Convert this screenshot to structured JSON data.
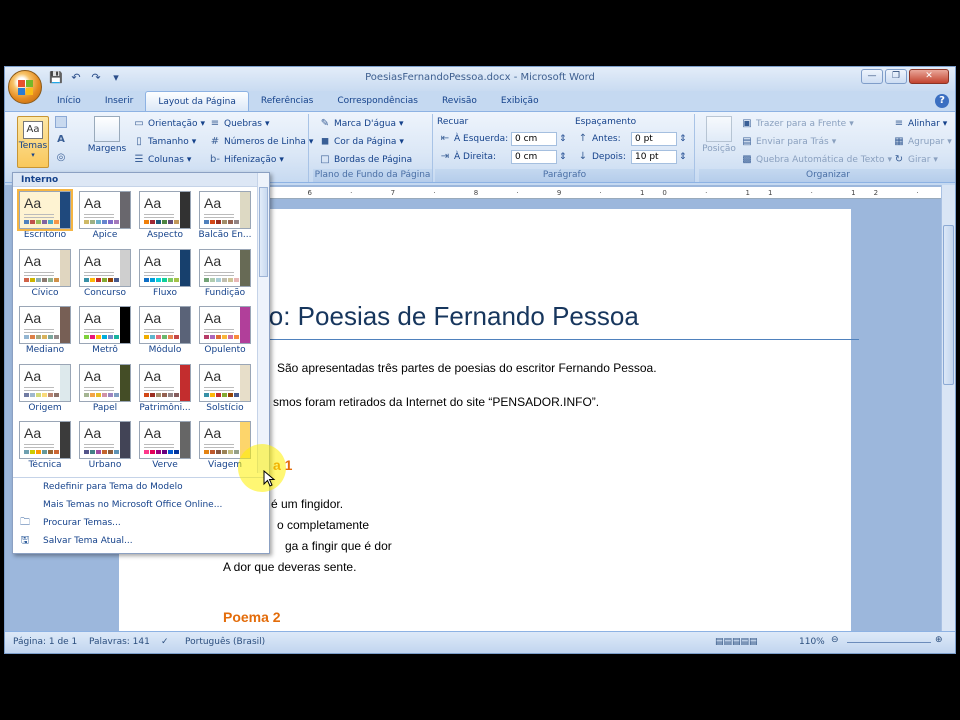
{
  "window": {
    "title": "PoesiasFernandoPessoa.docx - Microsoft Word"
  },
  "quick_access": {
    "icons": [
      "save-icon",
      "undo-icon",
      "redo-icon",
      "customize-icon"
    ]
  },
  "tabs": [
    "Início",
    "Inserir",
    "Layout da Página",
    "Referências",
    "Correspondências",
    "Revisão",
    "Exibição"
  ],
  "active_tab": "Layout da Página",
  "ribbon": {
    "temas_label": "Temas",
    "margens_label": "Margens",
    "orientacao": "Orientação",
    "tamanho": "Tamanho",
    "colunas": "Colunas",
    "quebras": "Quebras",
    "numeros_linha": "Números de Linha",
    "hifenizacao": "Hifenização",
    "marca_dagua": "Marca D'água",
    "cor_pagina": "Cor da Página",
    "bordas_pagina": "Bordas de Página",
    "plano_fundo_label": "Plano de Fundo da Página",
    "recuar": "Recuar",
    "esquerda_label": "À Esquerda:",
    "esquerda_value": "0 cm",
    "direita_label": "À Direita:",
    "direita_value": "0 cm",
    "espacamento": "Espaçamento",
    "antes_label": "Antes:",
    "antes_value": "0 pt",
    "depois_label": "Depois:",
    "depois_value": "10 pt",
    "paragrafo_label": "Parágrafo",
    "posicao": "Posição",
    "trazer_frente": "Trazer para a Frente",
    "enviar_tras": "Enviar para Trás",
    "quebra_automatica": "Quebra Automática de Texto",
    "alinhar": "Alinhar",
    "agrupar": "Agrupar",
    "girar": "Girar",
    "organizar_label": "Organizar"
  },
  "ruler": {
    "ticks": "· 6 · 7 · 8 · 9 · 10 · 11 · 12 · 13 · 14 · 15 · 16 · 17 ·"
  },
  "document": {
    "title": "lo: Poesias de Fernando Pessoa",
    "intro1": "São apresentadas três partes de poesias do escritor Fernando Pessoa.",
    "intro2": "smos foram retirados da Internet do site “PENSADOR.INFO”.",
    "poema1_heading": "a 1",
    "line1": "é um fingidor.",
    "line2": "o completamente",
    "line3": "ga a fingir que é dor",
    "line4": "A dor que deveras sente.",
    "poema2_heading": "Poema 2"
  },
  "gallery": {
    "header": "Interno",
    "themes": [
      {
        "name": "Escritório",
        "bar": "#1f497d",
        "sw": [
          "#4f81bd",
          "#c0504d",
          "#9bbb59",
          "#8064a2",
          "#4bacc6",
          "#f79646"
        ],
        "selected": true
      },
      {
        "name": "Ápice",
        "bar": "#69676d",
        "sw": [
          "#ceb966",
          "#9cb084",
          "#6bb1c9",
          "#6585cf",
          "#7e6bc9",
          "#a379bb"
        ],
        "selected": false
      },
      {
        "name": "Aspecto",
        "bar": "#323232",
        "sw": [
          "#f07f09",
          "#9f2936",
          "#1b587c",
          "#4e8542",
          "#604878",
          "#c19859"
        ],
        "selected": false
      },
      {
        "name": "Balcão En...",
        "bar": "#ddd9c3",
        "sw": [
          "#4f81bd",
          "#d34817",
          "#9b2d1f",
          "#a28e6a",
          "#956251",
          "#918485"
        ],
        "selected": false
      },
      {
        "name": "Cívico",
        "bar": "#e0d6c0",
        "sw": [
          "#d16349",
          "#ccb400",
          "#8cadae",
          "#8c7b70",
          "#8fb08c",
          "#d19049"
        ],
        "selected": false
      },
      {
        "name": "Concurso",
        "bar": "#cfcfcf",
        "sw": [
          "#3891a7",
          "#feb80a",
          "#c32d2e",
          "#84aa33",
          "#964305",
          "#475a8d"
        ],
        "selected": false
      },
      {
        "name": "Fluxo",
        "bar": "#17406d",
        "sw": [
          "#0f6fc6",
          "#009dd9",
          "#0bd0d9",
          "#10cf9b",
          "#7cca62",
          "#a5c249"
        ],
        "selected": false
      },
      {
        "name": "Fundição",
        "bar": "#676a55",
        "sw": [
          "#72a376",
          "#b0ccb0",
          "#a8cdd7",
          "#c0beaf",
          "#cec597",
          "#e8b7b7"
        ],
        "selected": false
      },
      {
        "name": "Mediano",
        "bar": "#775f55",
        "sw": [
          "#94b6d2",
          "#dd8047",
          "#a5ab81",
          "#d8b25c",
          "#7ba79d",
          "#968c8c"
        ],
        "selected": false
      },
      {
        "name": "Metrô",
        "bar": "#000000",
        "sw": [
          "#7fd13b",
          "#ea157a",
          "#feb80a",
          "#00addc",
          "#738ac8",
          "#1ab39f"
        ],
        "selected": false
      },
      {
        "name": "Módulo",
        "bar": "#5a6378",
        "sw": [
          "#f0ad00",
          "#60b5cc",
          "#e66c7d",
          "#6bb76d",
          "#e88651",
          "#c64847"
        ],
        "selected": false
      },
      {
        "name": "Opulento",
        "bar": "#b13f9a",
        "sw": [
          "#b83d68",
          "#ac66bb",
          "#de6c36",
          "#f9b639",
          "#cf6da4",
          "#fa8d3d"
        ],
        "selected": false
      },
      {
        "name": "Origem",
        "bar": "#dde9ec",
        "sw": [
          "#727ca3",
          "#9fb8cd",
          "#d2da7a",
          "#fada7a",
          "#b88472",
          "#8e736a"
        ],
        "selected": false
      },
      {
        "name": "Papel",
        "bar": "#444d26",
        "sw": [
          "#a5b592",
          "#f3a447",
          "#e7bc29",
          "#d092a7",
          "#9c85c0",
          "#809ec2"
        ],
        "selected": false
      },
      {
        "name": "Patrimôni...",
        "bar": "#c32d2e",
        "sw": [
          "#d34817",
          "#9b2d1f",
          "#a28e6a",
          "#956251",
          "#918485",
          "#855d5d"
        ],
        "selected": false
      },
      {
        "name": "Solstício",
        "bar": "#e7dec9",
        "sw": [
          "#3891a7",
          "#feb80a",
          "#c32d2e",
          "#84aa33",
          "#964305",
          "#475a8d"
        ],
        "selected": false
      },
      {
        "name": "Técnica",
        "bar": "#3b3b3b",
        "sw": [
          "#6ea0b0",
          "#cccc00",
          "#ff9900",
          "#669999",
          "#996633",
          "#cc6633"
        ],
        "selected": false
      },
      {
        "name": "Urbano",
        "bar": "#424456",
        "sw": [
          "#53548a",
          "#438086",
          "#a04da3",
          "#c4652d",
          "#8b5d3d",
          "#5c92b5"
        ],
        "selected": false
      },
      {
        "name": "Verve",
        "bar": "#666666",
        "sw": [
          "#ff388c",
          "#e40059",
          "#9c007f",
          "#68007f",
          "#005bd3",
          "#00349e"
        ],
        "selected": false
      },
      {
        "name": "Viagem",
        "bar": "#fdd56b",
        "sw": [
          "#e48312",
          "#bd582c",
          "#865640",
          "#9b8357",
          "#c2bc80",
          "#94a088"
        ],
        "selected": false
      }
    ],
    "menu": [
      {
        "label": "Redefinir para Tema do Modelo",
        "icon": ""
      },
      {
        "label": "Mais Temas no Microsoft Office Online...",
        "icon": ""
      },
      {
        "label": "Procurar Temas...",
        "icon": "folder-icon"
      },
      {
        "label": "Salvar Tema Atual...",
        "icon": "save-theme-icon"
      }
    ]
  },
  "status": {
    "pagina": "Página: 1 de 1",
    "palavras": "Palavras: 141",
    "idioma": "Português (Brasil)",
    "zoom": "110%"
  }
}
